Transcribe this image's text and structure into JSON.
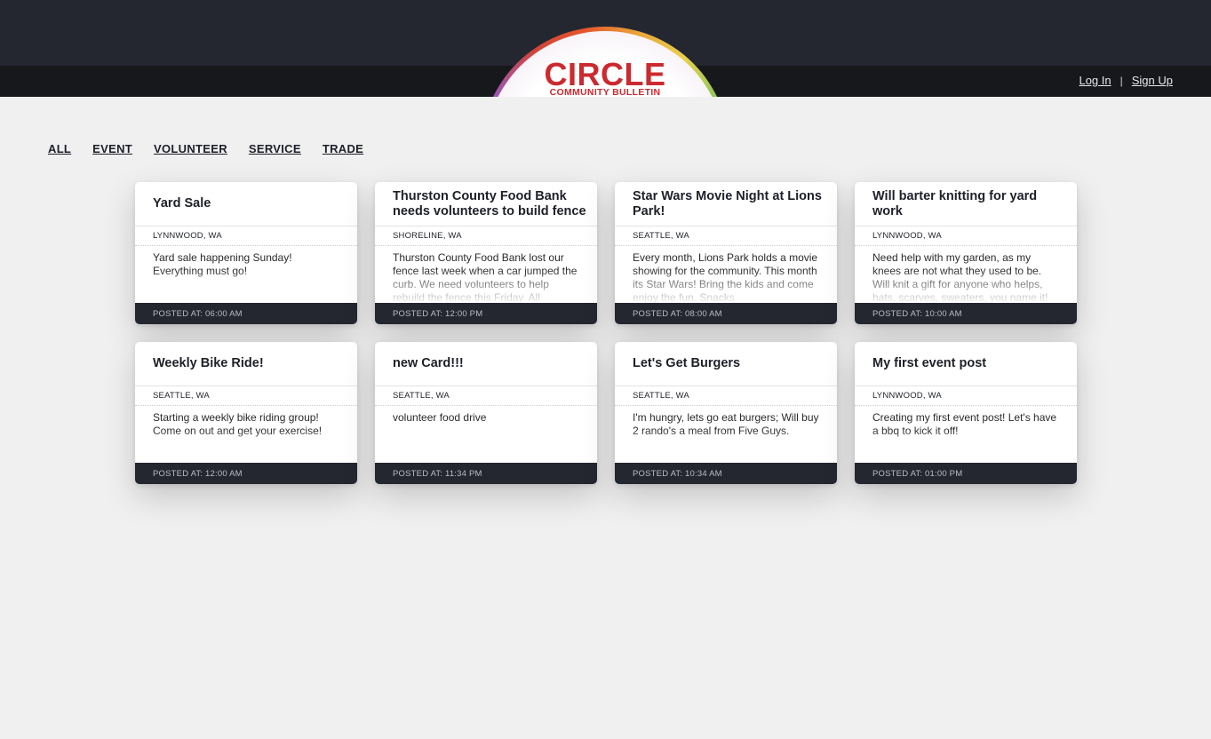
{
  "brand": {
    "title": "CIRCLE",
    "subtitle": "COMMUNITY BULLETIN"
  },
  "auth": {
    "login": "Log In",
    "separator": "|",
    "signup": "Sign Up"
  },
  "filters": [
    "ALL",
    "EVENT",
    "VOLUNTEER",
    "SERVICE",
    "TRADE"
  ],
  "posted_prefix": "POSTED AT:",
  "cards": [
    {
      "title": "Yard Sale",
      "location": "LYNNWOOD, WA",
      "body": "Yard sale happening Sunday! Everything must go!",
      "time": "06:00 AM"
    },
    {
      "title": "Thurston County Food Bank needs volunteers to build fence",
      "location": "SHORELINE, WA",
      "body": "Thurston County Food Bank lost our fence last week when a car jumped the curb. We need volunteers to help rebuild the fence this Friday. All",
      "time": "12:00 PM"
    },
    {
      "title": "Star Wars Movie Night at Lions Park!",
      "location": "SEATTLE, WA",
      "body": "Every month, Lions Park holds a movie showing for the community. This month its Star Wars! Bring the kids and come enjoy the fun. Snacks",
      "time": "08:00 AM"
    },
    {
      "title": "Will barter knitting for yard work",
      "location": "LYNNWOOD, WA",
      "body": "Need help with my garden, as my knees are not what they used to be. Will knit a gift for anyone who helps, hats, scarves, sweaters, you name it!",
      "time": "10:00 AM"
    },
    {
      "title": "Weekly Bike Ride!",
      "location": "SEATTLE, WA",
      "body": "Starting a weekly bike riding group! Come on out and get your exercise!",
      "time": "12:00 AM"
    },
    {
      "title": "new Card!!!",
      "location": "SEATTLE, WA",
      "body": "volunteer food drive",
      "time": "11:34 PM"
    },
    {
      "title": "Let's Get Burgers",
      "location": "SEATTLE, WA",
      "body": "I'm hungry, lets go eat burgers; Will buy 2 rando's a meal from Five Guys.",
      "time": "10:34 AM"
    },
    {
      "title": "My first event post",
      "location": "LYNNWOOD, WA",
      "body": "Creating my first event post! Let's have a bbq to kick it off!",
      "time": "01:00 PM"
    }
  ]
}
